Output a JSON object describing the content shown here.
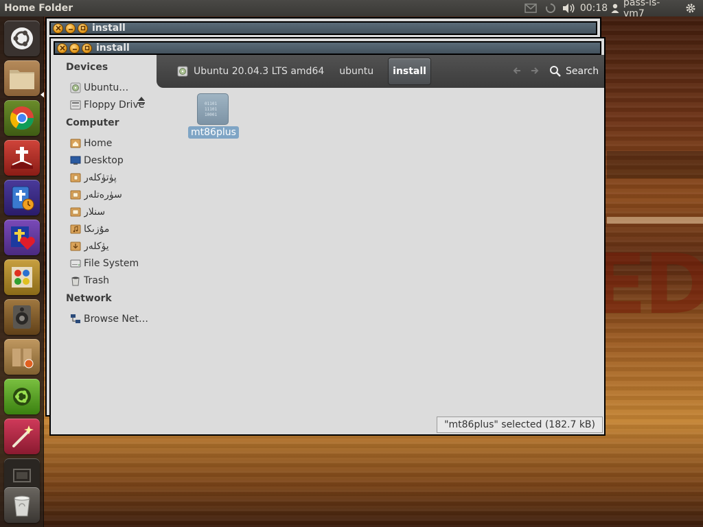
{
  "panel": {
    "title": "Home Folder",
    "clock": "00:18",
    "user": "pass-is-vm7",
    "icons": [
      "mail-icon",
      "network-icon",
      "volume-icon",
      "user-icon",
      "gear-icon"
    ]
  },
  "wallpaper": {
    "text": "ED"
  },
  "launcher": {
    "items": [
      {
        "name": "dash-button",
        "icon": "ubuntu-logo-icon"
      },
      {
        "name": "files-launcher",
        "icon": "folder-icon"
      },
      {
        "name": "chrome-launcher",
        "icon": "chrome-icon"
      },
      {
        "name": "bible-app-launcher",
        "icon": "bible-icon"
      },
      {
        "name": "bible-clock-launcher",
        "icon": "bible-clock-icon"
      },
      {
        "name": "cross-heart-launcher",
        "icon": "cross-heart-icon"
      },
      {
        "name": "paint-launcher",
        "icon": "paint-icon"
      },
      {
        "name": "speaker-launcher",
        "icon": "speaker-icon"
      },
      {
        "name": "package-launcher",
        "icon": "package-icon"
      },
      {
        "name": "ubuntu-software-launcher",
        "icon": "ubuntu-software-icon"
      },
      {
        "name": "magic-wand-launcher",
        "icon": "wand-icon"
      },
      {
        "name": "workspace-launcher",
        "icon": "workspace-icon"
      },
      {
        "name": "trash-launcher",
        "icon": "trash-icon"
      }
    ]
  },
  "back_window": {
    "title": "install"
  },
  "window": {
    "title": "install",
    "sidebar": {
      "devices_header": "Devices",
      "computer_header": "Computer",
      "network_header": "Network",
      "devices": [
        {
          "label": "Ubuntu…",
          "icon": "disc-icon"
        },
        {
          "label": "Floppy Drive",
          "icon": "floppy-icon"
        }
      ],
      "computer": [
        {
          "label": "Home",
          "icon": "home-folder-icon"
        },
        {
          "label": "Desktop",
          "icon": "desktop-icon"
        },
        {
          "label": "پۈتۈكلەر",
          "icon": "documents-folder-icon"
        },
        {
          "label": "سۈرەتلەر",
          "icon": "pictures-folder-icon"
        },
        {
          "label": "سنلار",
          "icon": "videos-folder-icon"
        },
        {
          "label": "مۇزىكا",
          "icon": "music-folder-icon"
        },
        {
          "label": "يۈكلەر",
          "icon": "downloads-folder-icon"
        },
        {
          "label": "File System",
          "icon": "harddisk-icon"
        },
        {
          "label": "Trash",
          "icon": "trash-icon"
        }
      ],
      "network": [
        {
          "label": "Browse Net…",
          "icon": "network-icon"
        }
      ]
    },
    "toolbar": {
      "breadcrumbs": [
        "Ubuntu 20.04.3 LTS amd64",
        "ubuntu",
        "install"
      ],
      "active_crumb": "install",
      "search_label": "Search"
    },
    "files": [
      {
        "name": "mt86plus",
        "icon": "binary-file-icon",
        "selected": true
      }
    ],
    "status": "\"mt86plus\" selected (182.7 kB)"
  },
  "colors": {
    "panel_bg": "#3c3b37",
    "selection": "#7fa5c5",
    "titlebar": "#4d5c68",
    "button_orange": "#e59b1c"
  }
}
